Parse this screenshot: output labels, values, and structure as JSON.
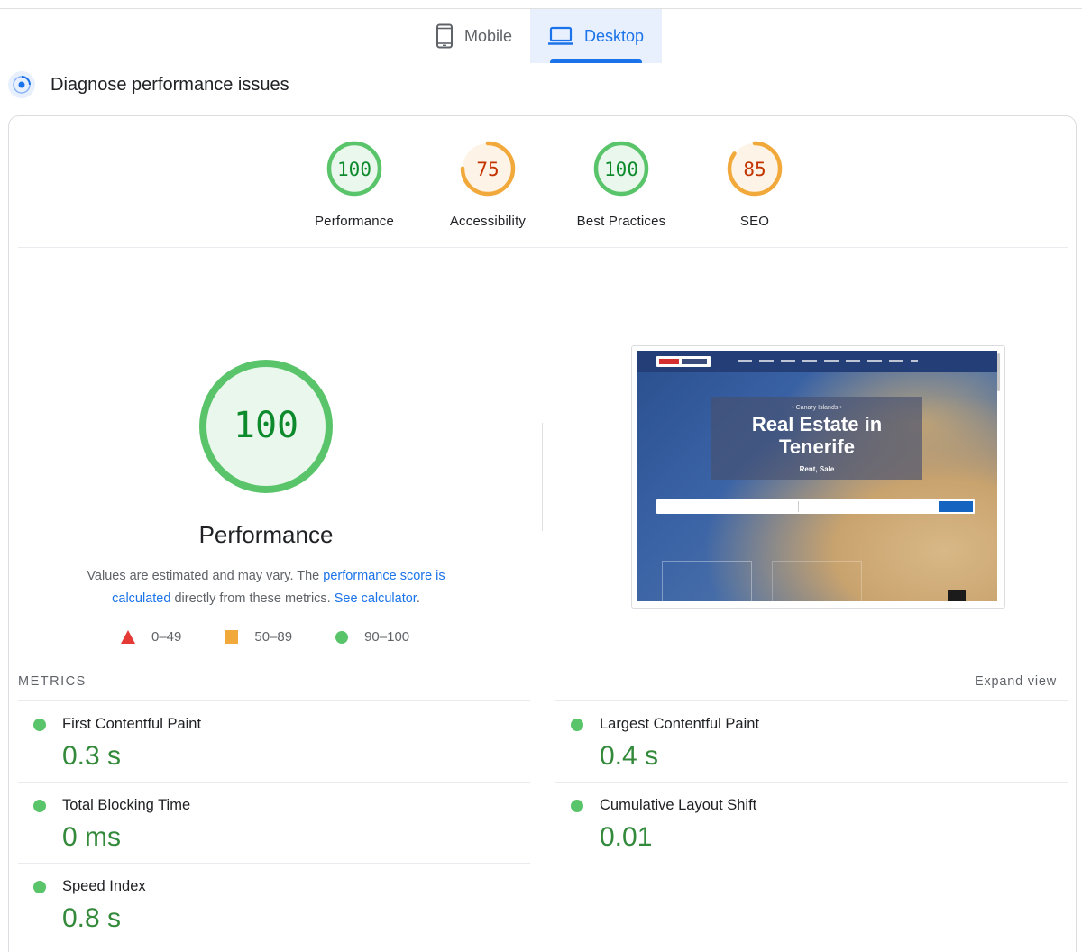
{
  "tabs": [
    {
      "label": "Mobile",
      "icon": "smartphone-icon",
      "active": false
    },
    {
      "label": "Desktop",
      "icon": "laptop-icon",
      "active": true
    }
  ],
  "diagnose": {
    "title": "Diagnose performance issues",
    "icon": "performance-dial-icon"
  },
  "scores": [
    {
      "label": "Performance",
      "value": "100",
      "score": 100,
      "color": "#0c8a2c",
      "ring": "#5ac46a",
      "fill": "#eaf7ec"
    },
    {
      "label": "Accessibility",
      "value": "75",
      "score": 75,
      "color": "#c33300",
      "ring": "#f2a93b",
      "fill": "#fdf3e6"
    },
    {
      "label": "Best Practices",
      "value": "100",
      "score": 100,
      "color": "#0c8a2c",
      "ring": "#5ac46a",
      "fill": "#eaf7ec"
    },
    {
      "label": "SEO",
      "value": "85",
      "score": 85,
      "color": "#c33300",
      "ring": "#f2a93b",
      "fill": "#fdf3e6"
    }
  ],
  "main": {
    "score": "100",
    "title": "Performance",
    "desc_prefix": "Values are estimated and may vary. The ",
    "desc_link1": "performance score is calculated",
    "desc_middle": " directly from these metrics. ",
    "desc_link2": "See calculator",
    "desc_suffix": "."
  },
  "legend": [
    {
      "label": "0–49",
      "shape": "triangle",
      "color": "#e53935"
    },
    {
      "label": "50–89",
      "shape": "square",
      "color": "#f2a93b"
    },
    {
      "label": "90–100",
      "shape": "circle",
      "color": "#5ac46a"
    }
  ],
  "screenshot": {
    "subtitle": "• Canary Islands •",
    "headline_line1": "Real Estate in",
    "headline_line2": "Tenerife",
    "tagline": "Rent, Sale"
  },
  "metrics": {
    "label": "METRICS",
    "expand": "Expand view",
    "left": [
      {
        "name": "First Contentful Paint",
        "value": "0.3 s"
      },
      {
        "name": "Total Blocking Time",
        "value": "0 ms"
      },
      {
        "name": "Speed Index",
        "value": "0.8 s"
      }
    ],
    "right": [
      {
        "name": "Largest Contentful Paint",
        "value": "0.4 s"
      },
      {
        "name": "Cumulative Layout Shift",
        "value": "0.01"
      }
    ]
  }
}
